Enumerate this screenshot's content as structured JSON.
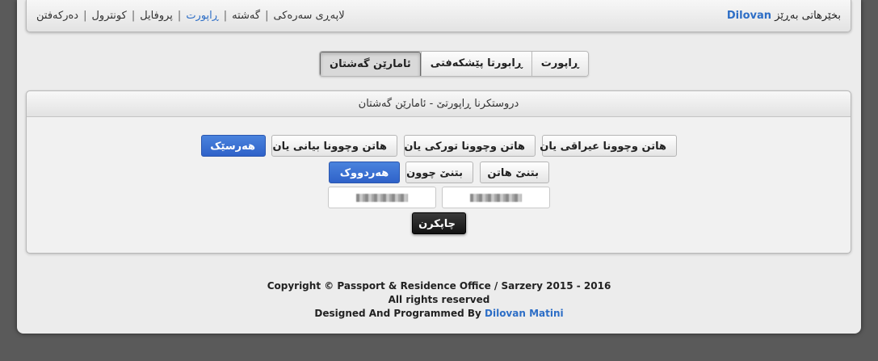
{
  "header": {
    "welcome_prefix": "بخێرهاتی بەڕێز",
    "username": "Dilovan"
  },
  "nav": {
    "items": [
      "لاپەڕی سەرەکی",
      "گەشتە",
      "ڕاپورت",
      "پروفایل",
      "کونترول",
      "دەرکەفتن"
    ],
    "separator": "|",
    "active_index": 2
  },
  "tabs": [
    {
      "label": "ڕاپورت",
      "active": false
    },
    {
      "label": "ڕابورتا پێشکەفتی",
      "active": false
    },
    {
      "label": "ئامارێن گەشتان",
      "active": true
    }
  ],
  "panel": {
    "title": "دروستکرنا ڕاپورتێ - ئامارێن گەشتان",
    "row1": {
      "btn_iraq": "هاتن وچوونا عیراقی یان",
      "btn_turkey": "هاتن وچوونا تورکی یان",
      "btn_foreign": "هاتن وچوونا بیانی یان",
      "btn_all": "هەرسێک"
    },
    "row2": {
      "btn_entry": "بتنێ هاتن",
      "btn_exit": "بتنێ چوون",
      "btn_both": "هەردووک"
    },
    "date_from": "",
    "date_to": "",
    "print_label": "چاپکرن"
  },
  "footer": {
    "line1": "Copyright © Passport & Residence Office / Sarzery 2015 - 2016",
    "line2": "All rights reserved",
    "line3_prefix": "Designed And Programmed By",
    "author": "Dilovan Matini"
  },
  "colors": {
    "accent": "#2d6ec6",
    "primary_button": "#3a6fd4",
    "dark_button": "#1a1a1a"
  }
}
